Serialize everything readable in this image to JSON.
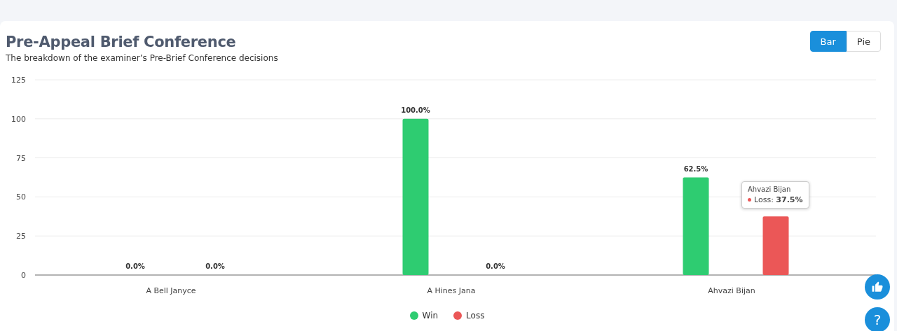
{
  "card": {
    "title": "Pre-Appeal Brief Conference",
    "subtitle": "The breakdown of the examiner’s Pre-Brief Conference decisions"
  },
  "view_toggle": [
    {
      "label": "Bar",
      "selected": true
    },
    {
      "label": "Pie",
      "selected": false
    }
  ],
  "chart_data": {
    "type": "bar",
    "categories": [
      "A Bell Janyce",
      "A Hines Jana",
      "Ahvazi Bijan"
    ],
    "series": [
      {
        "name": "Win",
        "color": "#2ecc71",
        "values": [
          0,
          100,
          62.5
        ]
      },
      {
        "name": "Loss",
        "color": "#eb5757",
        "values": [
          0,
          0,
          37.5
        ]
      }
    ],
    "ylim": [
      0,
      125
    ],
    "grid": true,
    "yticks": [
      0,
      25,
      50,
      75,
      100,
      125
    ],
    "value_labels": [
      [
        "0.0%",
        "100.0%",
        "62.5%"
      ],
      [
        "0.0%",
        "0.0%",
        null
      ]
    ]
  },
  "tooltip": {
    "title": "Ahvazi Bijan",
    "text": "Loss:",
    "value": "37.5%",
    "color": "#eb5757"
  },
  "help_button": {
    "label": "?"
  }
}
